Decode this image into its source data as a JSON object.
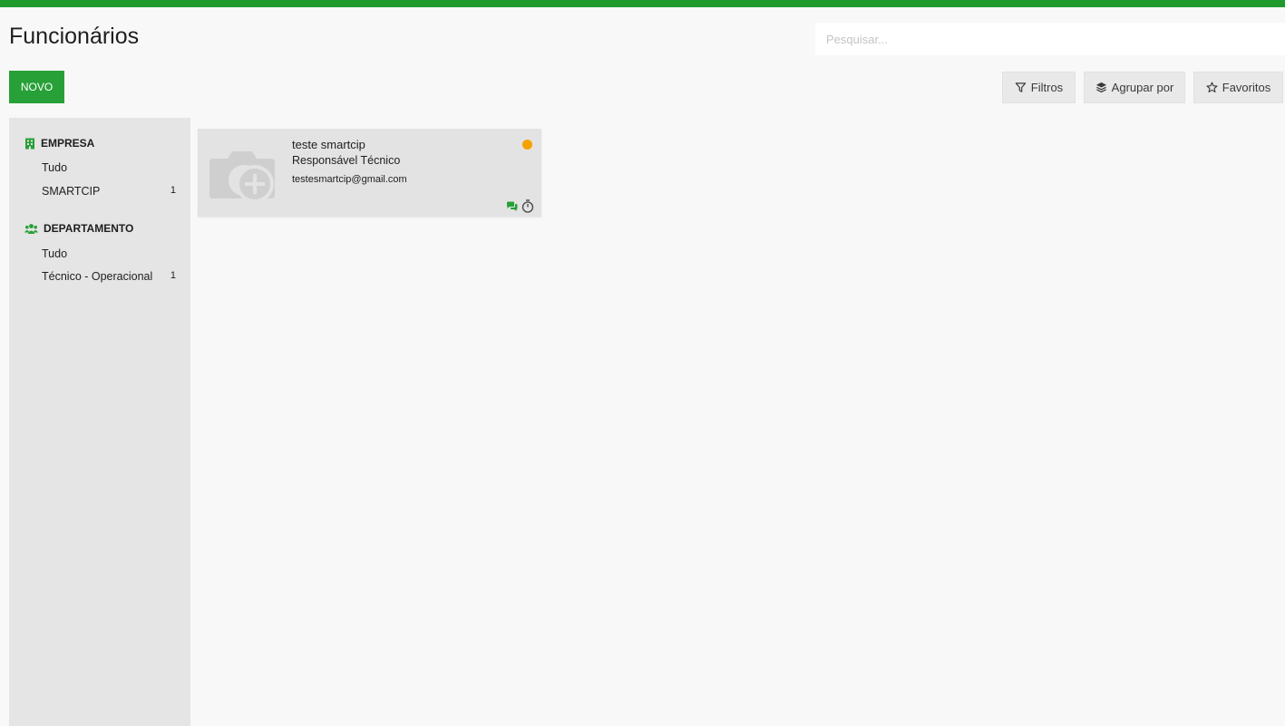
{
  "header": {
    "title": "Funcionários",
    "search_placeholder": "Pesquisar..."
  },
  "toolbar": {
    "new_label": "NOVO",
    "filters_label": "Filtros",
    "group_by_label": "Agrupar por",
    "favorites_label": "Favoritos"
  },
  "sidebar": {
    "sections": [
      {
        "title": "EMPRESA",
        "icon": "building-icon",
        "items": [
          {
            "label": "Tudo",
            "count": ""
          },
          {
            "label": "SMARTCIP",
            "count": "1"
          }
        ]
      },
      {
        "title": "DEPARTAMENTO",
        "icon": "users-icon",
        "items": [
          {
            "label": "Tudo",
            "count": ""
          },
          {
            "label": "Técnico - Operacional",
            "count": "1"
          }
        ]
      }
    ]
  },
  "cards": [
    {
      "name": "teste smartcip",
      "job_title": "Responsável Técnico",
      "email": "testesmartcip@gmail.com",
      "status_color": "#f5a300",
      "icons": [
        "camera-placeholder-icon",
        "chat-icon",
        "timer-icon"
      ]
    }
  ],
  "colors": {
    "brand": "#1f9b2e",
    "primary_button": "#28a038",
    "status_away": "#f5a300"
  }
}
